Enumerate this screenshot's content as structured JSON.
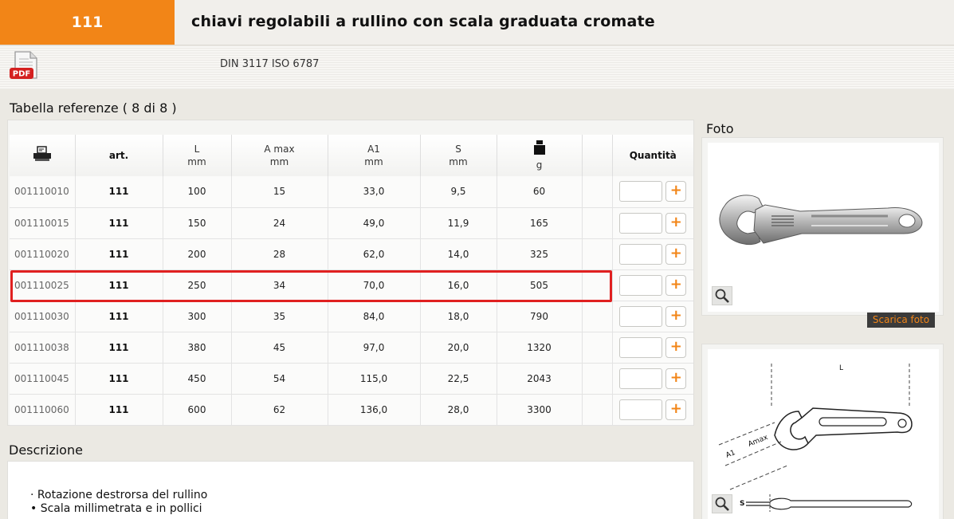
{
  "header": {
    "code": "111",
    "title": "chiavi regolabili a rullino con scala graduata cromate"
  },
  "norm": {
    "pdf_label": "PDF",
    "text": "DIN 3117 ISO 6787"
  },
  "table": {
    "title": "Tabella referenze ( 8 di 8 )",
    "columns": {
      "art": "art.",
      "L": "L",
      "L_unit": "mm",
      "A": "A max",
      "A_unit": "mm",
      "A1": "A1",
      "A1_unit": "mm",
      "S": "S",
      "S_unit": "mm",
      "weight_unit": "g",
      "qty": "Quantità"
    },
    "rows": [
      {
        "code": "001110010",
        "art": "111",
        "L": "100",
        "A": "15",
        "A1": "33,0",
        "S": "9,5",
        "g": "60"
      },
      {
        "code": "001110015",
        "art": "111",
        "L": "150",
        "A": "24",
        "A1": "49,0",
        "S": "11,9",
        "g": "165"
      },
      {
        "code": "001110020",
        "art": "111",
        "L": "200",
        "A": "28",
        "A1": "62,0",
        "S": "14,0",
        "g": "325"
      },
      {
        "code": "001110025",
        "art": "111",
        "L": "250",
        "A": "34",
        "A1": "70,0",
        "S": "16,0",
        "g": "505"
      },
      {
        "code": "001110030",
        "art": "111",
        "L": "300",
        "A": "35",
        "A1": "84,0",
        "S": "18,0",
        "g": "790"
      },
      {
        "code": "001110038",
        "art": "111",
        "L": "380",
        "A": "45",
        "A1": "97,0",
        "S": "20,0",
        "g": "1320"
      },
      {
        "code": "001110045",
        "art": "111",
        "L": "450",
        "A": "54",
        "A1": "115,0",
        "S": "22,5",
        "g": "2043"
      },
      {
        "code": "001110060",
        "art": "111",
        "L": "600",
        "A": "62",
        "A1": "136,0",
        "S": "28,0",
        "g": "3300"
      }
    ],
    "plus_glyph": "+",
    "highlight_color": "#e02020"
  },
  "description": {
    "title": "Descrizione",
    "items": [
      "· Rotazione destrorsa del rullino",
      "• Scala millimetrata e in pollici"
    ]
  },
  "photo": {
    "title": "Foto",
    "download_label": "Scarica foto"
  },
  "drawing": {
    "label_L": "L",
    "label_A1": "A1",
    "label_Amax": "Amax",
    "label_S": "S"
  },
  "colors": {
    "accent": "#f28517",
    "highlight": "#e02020"
  }
}
